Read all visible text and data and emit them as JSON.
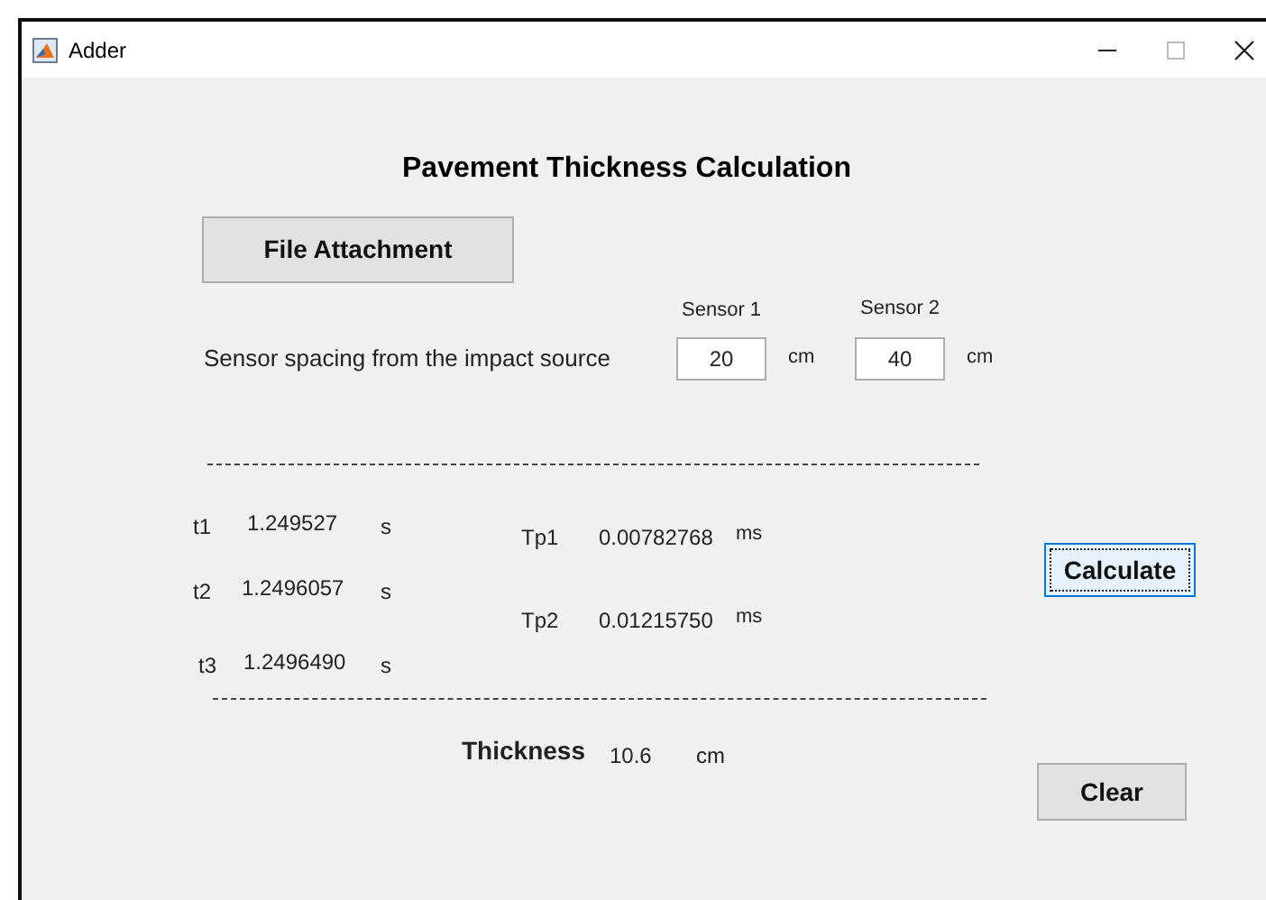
{
  "window": {
    "title": "Adder"
  },
  "heading": "Pavement Thickness Calculation",
  "file_button": {
    "label": "File Attachment"
  },
  "spacing": {
    "label": "Sensor spacing from the impact source",
    "sensors": [
      {
        "label": "Sensor 1",
        "value": "20",
        "unit": "cm"
      },
      {
        "label": "Sensor 2",
        "value": "40",
        "unit": "cm"
      }
    ]
  },
  "times": [
    {
      "label": "t1",
      "value": "1.249527",
      "unit": "s"
    },
    {
      "label": "t2",
      "value": "1.2496057",
      "unit": "s"
    },
    {
      "label": "t3",
      "value": "1.2496490",
      "unit": "s"
    }
  ],
  "periods": [
    {
      "label": "Tp1",
      "value": "0.00782768",
      "unit": "ms"
    },
    {
      "label": "Tp2",
      "value": "0.01215750",
      "unit": "ms"
    }
  ],
  "calculate_button": {
    "label": "Calculate",
    "focused": true
  },
  "thickness": {
    "label": "Thickness",
    "value": "10.6",
    "unit": "cm"
  },
  "clear_button": {
    "label": "Clear",
    "focused": false
  }
}
